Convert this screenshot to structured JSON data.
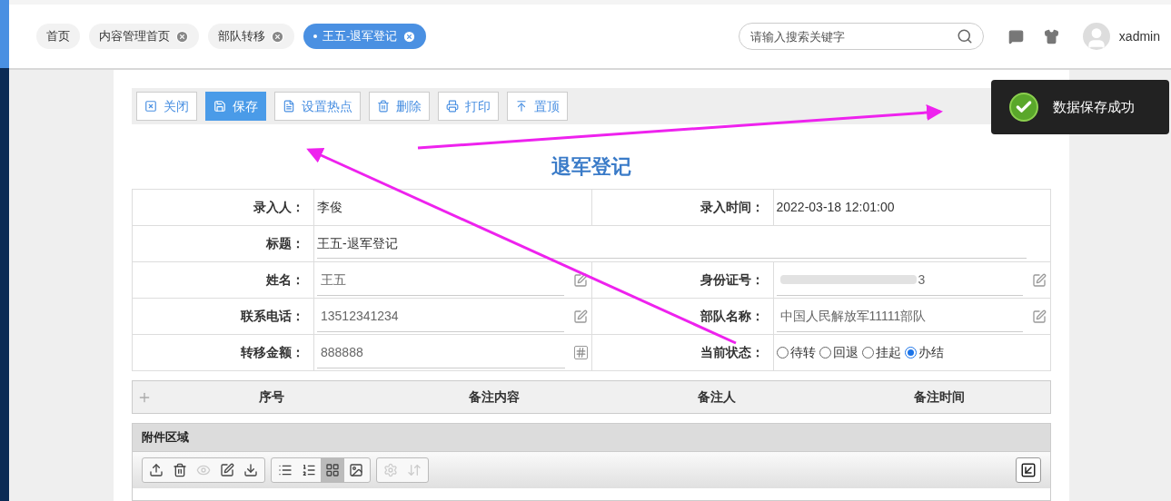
{
  "tabs": [
    {
      "label": "首页",
      "selected": false,
      "closable": false
    },
    {
      "label": "内容管理首页",
      "selected": false,
      "closable": true
    },
    {
      "label": "部队转移",
      "selected": false,
      "closable": true
    },
    {
      "label": "王五-退军登记",
      "selected": true,
      "closable": true
    }
  ],
  "search": {
    "placeholder": "请输入搜索关键字"
  },
  "user": {
    "name": "xadmin"
  },
  "toolbar": [
    {
      "label": "关闭",
      "selected": false
    },
    {
      "label": "保存",
      "selected": true
    },
    {
      "label": "设置热点",
      "selected": false
    },
    {
      "label": "删除",
      "selected": false
    },
    {
      "label": "打印",
      "selected": false
    },
    {
      "label": "置顶",
      "selected": false
    }
  ],
  "toast": {
    "message": "数据保存成功"
  },
  "form": {
    "title": "退军登记",
    "rows": [
      [
        {
          "label": "录入人：",
          "value": "李俊",
          "kind": "text"
        },
        {
          "label": "录入时间：",
          "value": "2022-03-18 12:01:00",
          "kind": "text"
        }
      ],
      [
        {
          "label": "标题：",
          "value": "王五-退军登记",
          "kind": "wide"
        }
      ],
      [
        {
          "label": "姓名：",
          "value": "王五",
          "kind": "input"
        },
        {
          "label": "身份证号：",
          "value": "3",
          "kind": "redacted"
        }
      ],
      [
        {
          "label": "联系电话：",
          "value": "13512341234",
          "kind": "input"
        },
        {
          "label": "部队名称：",
          "value": "中国人民解放军11111部队",
          "kind": "input"
        }
      ],
      [
        {
          "label": "转移金额：",
          "value": "888888",
          "kind": "number"
        },
        {
          "label": "当前状态：",
          "kind": "radio",
          "options": [
            {
              "label": "待转",
              "selected": false
            },
            {
              "label": "回退",
              "selected": false
            },
            {
              "label": "挂起",
              "selected": false
            },
            {
              "label": "办结",
              "selected": true
            }
          ]
        }
      ]
    ]
  },
  "notes_table": {
    "columns": [
      "序号",
      "备注内容",
      "备注人",
      "备注时间"
    ]
  },
  "attachments": {
    "title": "附件区域",
    "tools": [
      {
        "disabled": false,
        "selected": false
      },
      {
        "disabled": false,
        "selected": false
      },
      {
        "disabled": true,
        "selected": false
      },
      {
        "disabled": false,
        "selected": false
      },
      {
        "disabled": false,
        "selected": false
      },
      {
        "disabled": false,
        "selected": false
      },
      {
        "disabled": false,
        "selected": false
      },
      {
        "disabled": false,
        "selected": true
      },
      {
        "disabled": false,
        "selected": false
      },
      {
        "disabled": true,
        "selected": false
      },
      {
        "disabled": true,
        "selected": false
      }
    ]
  }
}
